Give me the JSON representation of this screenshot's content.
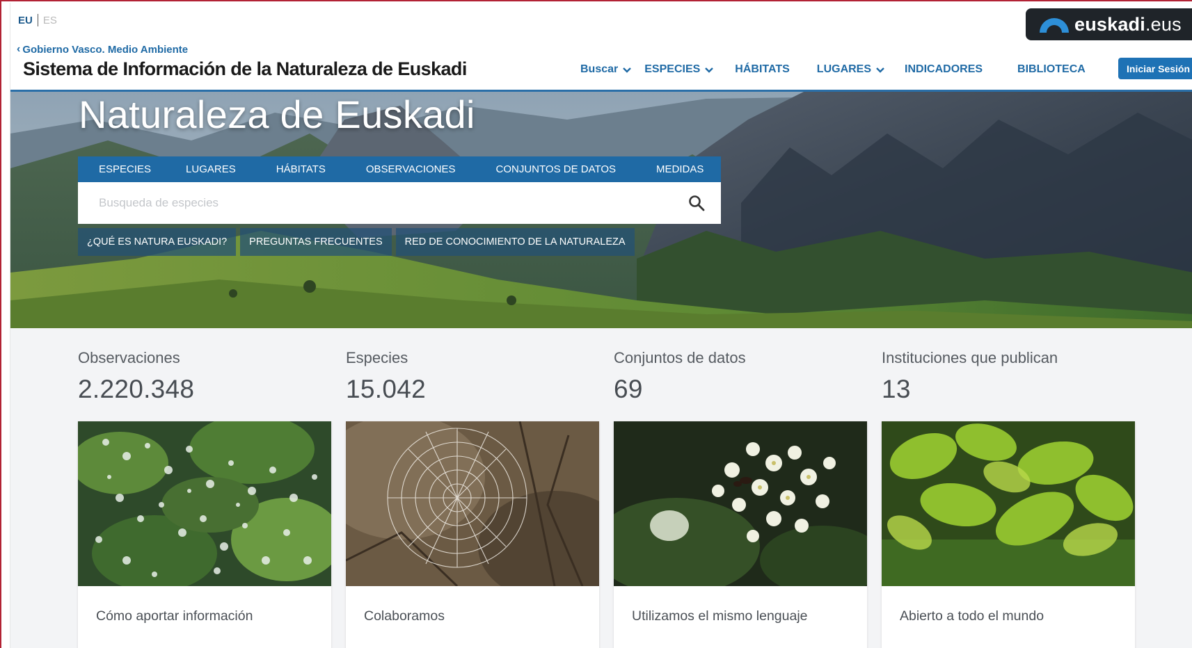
{
  "languages": {
    "active": "EU",
    "inactive": "ES"
  },
  "brand": {
    "name": "euskadi",
    "tld": ".eus"
  },
  "header": {
    "back_link": "Gobierno Vasco. Medio Ambiente",
    "site_title": "Sistema de Información de la Naturaleza de Euskadi",
    "nav": [
      {
        "label": "Buscar",
        "dropdown": true
      },
      {
        "label": "ESPECIES",
        "dropdown": true
      },
      {
        "label": "HÁBITATS",
        "dropdown": false
      },
      {
        "label": "LUGARES",
        "dropdown": true
      },
      {
        "label": "INDICADORES",
        "dropdown": false
      },
      {
        "label": "BIBLIOTECA",
        "dropdown": false
      }
    ],
    "login_label": "Iniciar Sesión"
  },
  "hero": {
    "title": "Naturaleza de Euskadi",
    "search_tabs": [
      "ESPECIES",
      "LUGARES",
      "HÁBITATS",
      "OBSERVACIONES",
      "CONJUNTOS DE DATOS",
      "MEDIDAS"
    ],
    "search_placeholder": "Busqueda de especies",
    "sub_links": [
      "¿QUÉ ES NATURA EUSKADI?",
      "PREGUNTAS FRECUENTES",
      "RED DE CONOCIMIENTO DE LA NATURALEZA"
    ]
  },
  "stats": [
    {
      "label": "Observaciones",
      "value": "2.220.348"
    },
    {
      "label": "Especies",
      "value": "15.042"
    },
    {
      "label": "Conjuntos de datos",
      "value": "69"
    },
    {
      "label": "Instituciones que publican",
      "value": "13"
    }
  ],
  "cards": [
    {
      "caption": "Cómo aportar información"
    },
    {
      "caption": "Colaboramos"
    },
    {
      "caption": "Utilizamos el mismo lenguaje"
    },
    {
      "caption": "Abierto a todo el mundo"
    }
  ],
  "colors": {
    "primary": "#1f6aa5",
    "header_rule": "#2a6fa8",
    "badge_bg": "#1f2429",
    "badge_arc": "#2d8fd8",
    "stats_bg": "#f3f4f6"
  }
}
